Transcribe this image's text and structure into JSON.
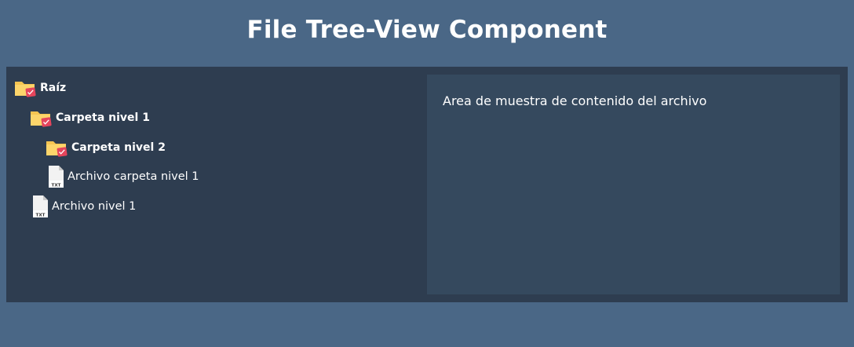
{
  "header": {
    "title": "File Tree-View Component"
  },
  "tree": {
    "items": [
      {
        "label": "Raíz",
        "type": "folder",
        "icon": "folder-icon",
        "level": 0
      },
      {
        "label": "Carpeta nivel 1",
        "type": "folder",
        "icon": "folder-icon",
        "level": 1
      },
      {
        "label": "Carpeta nivel 2",
        "type": "folder",
        "icon": "folder-icon",
        "level": 2
      },
      {
        "label": "Archivo carpeta nivel 1",
        "type": "file",
        "icon": "txt-file-icon",
        "file_badge": "TXT",
        "level": 2
      },
      {
        "label": "Archivo nivel 1",
        "type": "file",
        "icon": "txt-file-icon",
        "file_badge": "TXT",
        "level": 1
      }
    ]
  },
  "content": {
    "placeholder_text": "Area de muestra de contenido del archivo"
  },
  "colors": {
    "page_background": "#4a6786",
    "panel_background": "#2e3d50",
    "content_background": "#35495e",
    "folder_yellow": "#fcd56b",
    "check_badge_red": "#e5455c",
    "text": "#ffffff"
  }
}
